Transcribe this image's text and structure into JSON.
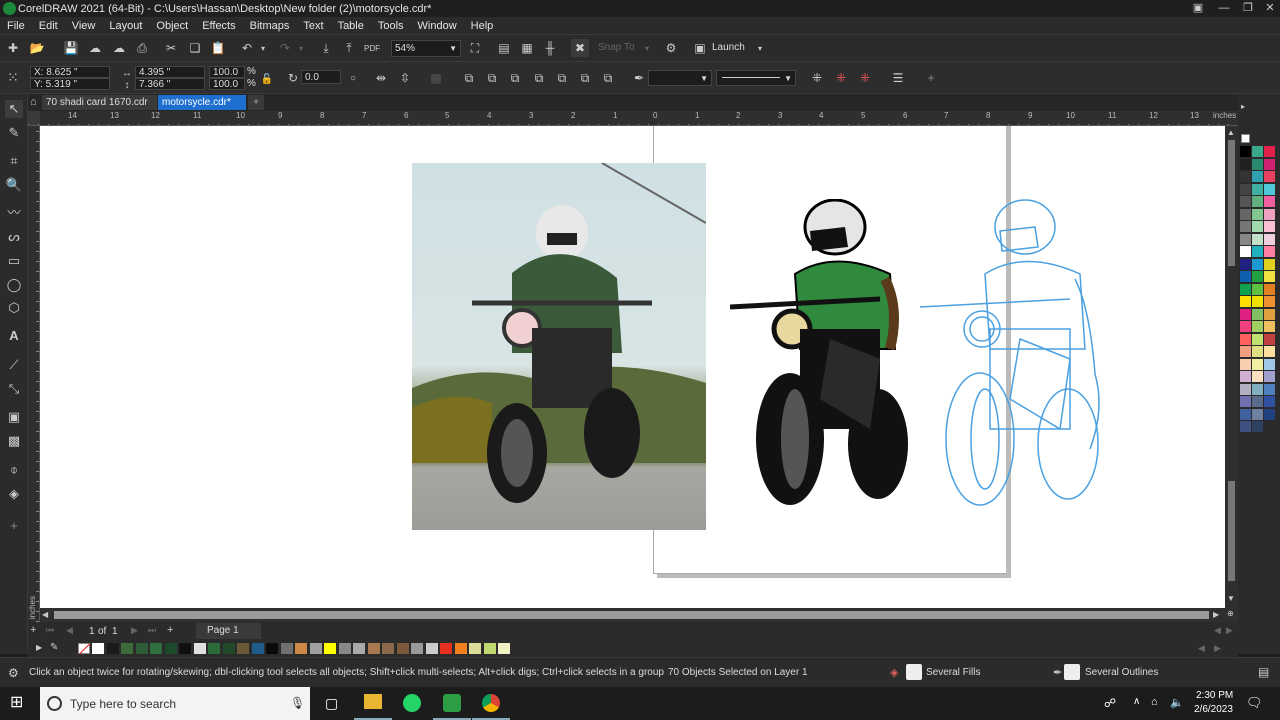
{
  "window": {
    "title": "CorelDRAW 2021 (64-Bit) - C:\\Users\\Hassan\\Desktop\\New folder (2)\\motorsycle.cdr*"
  },
  "menu": [
    "File",
    "Edit",
    "View",
    "Layout",
    "Object",
    "Effects",
    "Bitmaps",
    "Text",
    "Table",
    "Tools",
    "Window",
    "Help"
  ],
  "toolbar": {
    "zoom": "54%",
    "snap_to": "Snap To",
    "launch": "Launch"
  },
  "props": {
    "x": "X: 8.625 \"",
    "y": "Y: 5.319 \"",
    "w": "4.395 \"",
    "h": "7.366 \"",
    "sx": "100.0",
    "sy": "100.0",
    "pct1": "%",
    "pct2": "%",
    "angle": "0.0"
  },
  "tabs": [
    {
      "label": "70 shadi card 1670.cdr"
    },
    {
      "label": "motorsycle.cdr*"
    }
  ],
  "ruler": {
    "unit": "inches",
    "h_ticks": [
      "14",
      "13",
      "12",
      "11",
      "10",
      "9",
      "8",
      "7",
      "6",
      "5",
      "4",
      "3",
      "2",
      "1",
      "0",
      "1",
      "2",
      "3",
      "4",
      "5",
      "6",
      "7",
      "8",
      "9",
      "10",
      "11",
      "12",
      "13"
    ]
  },
  "pagebar": {
    "page_count": "1",
    "of": "of",
    "total": "1",
    "page_tab": "Page 1"
  },
  "status": {
    "hint": "Click an object twice for rotating/skewing; dbl-clicking tool selects all objects; Shift+click multi-selects; Alt+click digs; Ctrl+click selects in a group",
    "selection": "70 Objects Selected on Layer 1",
    "fill": "Several Fills",
    "outline": "Several Outlines"
  },
  "taskbar": {
    "search_placeholder": "Type here to search",
    "time": "2:30 PM",
    "date": "2/6/2023"
  },
  "doc_palette": [
    "#ffffff",
    "#1a1a1a",
    "#3b6b3b",
    "#2e5c38",
    "#2f6e3e",
    "#1d4a2a",
    "#0f0f0f",
    "#e0e0e0",
    "#2d6b3a",
    "#204a2a",
    "#6b5a3a",
    "#1f5c8a",
    "#0a0a0a",
    "#707070",
    "#cc8844",
    "#a0a0a0",
    "#ffff00",
    "#888888",
    "#aaaaaa",
    "#a87850",
    "#8a6a4a",
    "#7a5a3a",
    "#999999",
    "#cccccc",
    "#e83020",
    "#f08020",
    "#dddd99",
    "#c0d870",
    "#f0f0c0"
  ],
  "color_palette": [
    "#000000",
    "#3aa88a",
    "#e0204a",
    "#202020",
    "#2a8a70",
    "#d02070",
    "#333333",
    "#30a0b0",
    "#e84060",
    "#444444",
    "#40b0a0",
    "#50c8d8",
    "#555555",
    "#60b080",
    "#f060a0",
    "#666666",
    "#80c890",
    "#f0a0c0",
    "#777777",
    "#a0d8b0",
    "#f8c0d0",
    "#888888",
    "#c0e0c8",
    "#f0d0e0",
    "#ffffff",
    "#20b0c0",
    "#ff80a0",
    "#202080",
    "#1a9ad0",
    "#e0d020",
    "#1060b0",
    "#20a040",
    "#f0e040",
    "#10a050",
    "#60c040",
    "#e08020",
    "#ffe000",
    "#f0e000",
    "#f09030",
    "#e02080",
    "#80c060",
    "#e0a040",
    "#f04080",
    "#a0d060",
    "#f0c060",
    "#ff6060",
    "#c0e070",
    "#c04040",
    "#f0a080",
    "#e0e080",
    "#ffe0a0",
    "#f8d0b0",
    "#f0f0a0",
    "#a0c8e8",
    "#d0b0d0",
    "#f8e0c0",
    "#a0a0d0",
    "#b0b0c0",
    "#80b0c0",
    "#5080c0",
    "#7070b0",
    "#5a6a8a",
    "#3050a0",
    "#4060a0",
    "#7080a0",
    "#204080",
    "#405080",
    "#304060"
  ]
}
